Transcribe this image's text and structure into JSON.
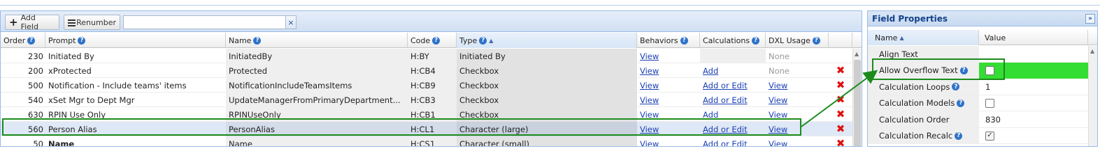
{
  "toolbar": {
    "add_field_label": "Add Field",
    "renumber_label": "Renumber",
    "search_value": "",
    "clear_label": "×"
  },
  "grid": {
    "columns": [
      "Order",
      "Prompt",
      "Name",
      "Code",
      "Type",
      "Behaviors",
      "Calculations",
      "DXL Usage"
    ],
    "sorted_column": "Type",
    "sort_direction": "ascending",
    "rows": [
      {
        "order": "230",
        "prompt": "Initiated By",
        "name": "InitiatedBy",
        "code": "H:BY",
        "type": "Initiated By",
        "behaviors": "View",
        "calculations": "",
        "dxl": "None",
        "deletable": false,
        "selected": false,
        "bold": false
      },
      {
        "order": "200",
        "prompt": "xProtected",
        "name": "Protected",
        "code": "H:CB4",
        "type": "Checkbox",
        "behaviors": "View",
        "calculations": "Add",
        "dxl": "None",
        "deletable": true,
        "selected": false,
        "bold": false
      },
      {
        "order": "500",
        "prompt": "Notification - Include teams' items",
        "name": "NotificationIncludeTeamsItems",
        "code": "H:CB9",
        "type": "Checkbox",
        "behaviors": "View",
        "calculations": "Add or Edit",
        "dxl": "View",
        "deletable": true,
        "selected": false,
        "bold": false
      },
      {
        "order": "540",
        "prompt": "xSet Mgr to Dept Mgr",
        "name": "UpdateManagerFromPrimaryDepartment...",
        "code": "H:CB3",
        "type": "Checkbox",
        "behaviors": "View",
        "calculations": "Add or Edit",
        "dxl": "View",
        "deletable": true,
        "selected": false,
        "bold": false
      },
      {
        "order": "630",
        "prompt": "RPIN Use Only",
        "name": "RPINUseOnly",
        "code": "H:CB1",
        "type": "Checkbox",
        "behaviors": "View",
        "calculations": "Add",
        "dxl": "View",
        "deletable": true,
        "selected": false,
        "bold": false
      },
      {
        "order": "560",
        "prompt": "Person Alias",
        "name": "PersonAlias",
        "code": "H:CL1",
        "type": "Character (large)",
        "behaviors": "View",
        "calculations": "Add or Edit",
        "dxl": "View",
        "deletable": true,
        "selected": true,
        "bold": false
      },
      {
        "order": "50",
        "prompt": "Name",
        "name": "Name",
        "code": "H:CS1",
        "type": "Character (small)",
        "behaviors": "View",
        "calculations": "Add or Edit",
        "dxl": "View",
        "deletable": true,
        "selected": false,
        "bold": true
      }
    ]
  },
  "properties": {
    "title": "Field Properties",
    "collapse_label": "»",
    "columns": [
      "Name",
      "Value"
    ],
    "rows": [
      {
        "name": "Align Text",
        "help": false,
        "value_type": "text",
        "value": ""
      },
      {
        "name": "Allow Overflow Text",
        "help": true,
        "value_type": "checkbox",
        "checked": false,
        "highlighted": true
      },
      {
        "name": "Calculation Loops",
        "help": true,
        "value_type": "text",
        "value": "1"
      },
      {
        "name": "Calculation Models",
        "help": true,
        "value_type": "checkbox",
        "checked": false
      },
      {
        "name": "Calculation Order",
        "help": false,
        "value_type": "text",
        "value": "830"
      },
      {
        "name": "Calculation Recalc",
        "help": true,
        "value_type": "checkbox",
        "checked": true
      }
    ]
  },
  "colors": {
    "accent_blue": "#99bbe8",
    "link": "#1b3fb3",
    "delete_red": "#e01010",
    "highlight_green": "#1c8b1c",
    "green_fill": "#33dd33"
  }
}
